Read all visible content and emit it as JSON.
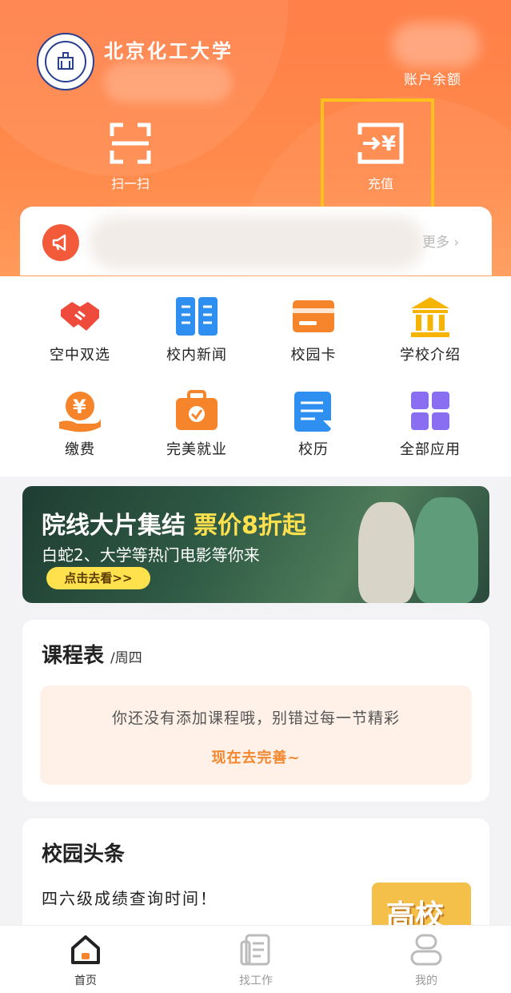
{
  "header": {
    "school_name": "北京化工大学",
    "balance_label": "账户余额",
    "actions": [
      {
        "label": "扫一扫",
        "icon": "scan-icon"
      },
      {
        "label": "充值",
        "icon": "recharge-icon"
      }
    ]
  },
  "notice": {
    "icon": "megaphone-icon",
    "more_label": "更多 ›"
  },
  "grid": [
    {
      "label": "空中双选",
      "icon": "handshake-icon",
      "color": "#ef4b3c"
    },
    {
      "label": "校内新闻",
      "icon": "news-book-icon",
      "color": "#2f8ff0"
    },
    {
      "label": "校园卡",
      "icon": "card-icon",
      "color": "#f5842a"
    },
    {
      "label": "学校介绍",
      "icon": "building-icon",
      "color": "#f5b400"
    },
    {
      "label": "缴费",
      "icon": "yuan-hand-icon",
      "color": "#f5842a"
    },
    {
      "label": "完美就业",
      "icon": "briefcase-icon",
      "color": "#f5842a"
    },
    {
      "label": "校历",
      "icon": "calendar-doc-icon",
      "color": "#2f8ff0"
    },
    {
      "label": "全部应用",
      "icon": "apps-grid-icon",
      "color": "#8a6ef2"
    }
  ],
  "banner": {
    "title": "院线大片集结",
    "title_highlight": "票价8折起",
    "subtitle": "白蛇2、大学等热门电影等你来",
    "button_label": "点击去看>>"
  },
  "schedule": {
    "title": "课程表",
    "day": "/周四",
    "empty_text": "你还没有添加课程哦，别错过每一节精彩",
    "action_label": "现在去完善~"
  },
  "headlines": {
    "title": "校园头条",
    "items": [
      {
        "text": "四六级成绩查询时间！",
        "thumb_text": "高校"
      }
    ]
  },
  "tabbar": [
    {
      "label": "首页",
      "icon": "home-icon",
      "active": true
    },
    {
      "label": "找工作",
      "icon": "resume-icon",
      "active": false
    },
    {
      "label": "我的",
      "icon": "profile-icon",
      "active": false
    }
  ]
}
